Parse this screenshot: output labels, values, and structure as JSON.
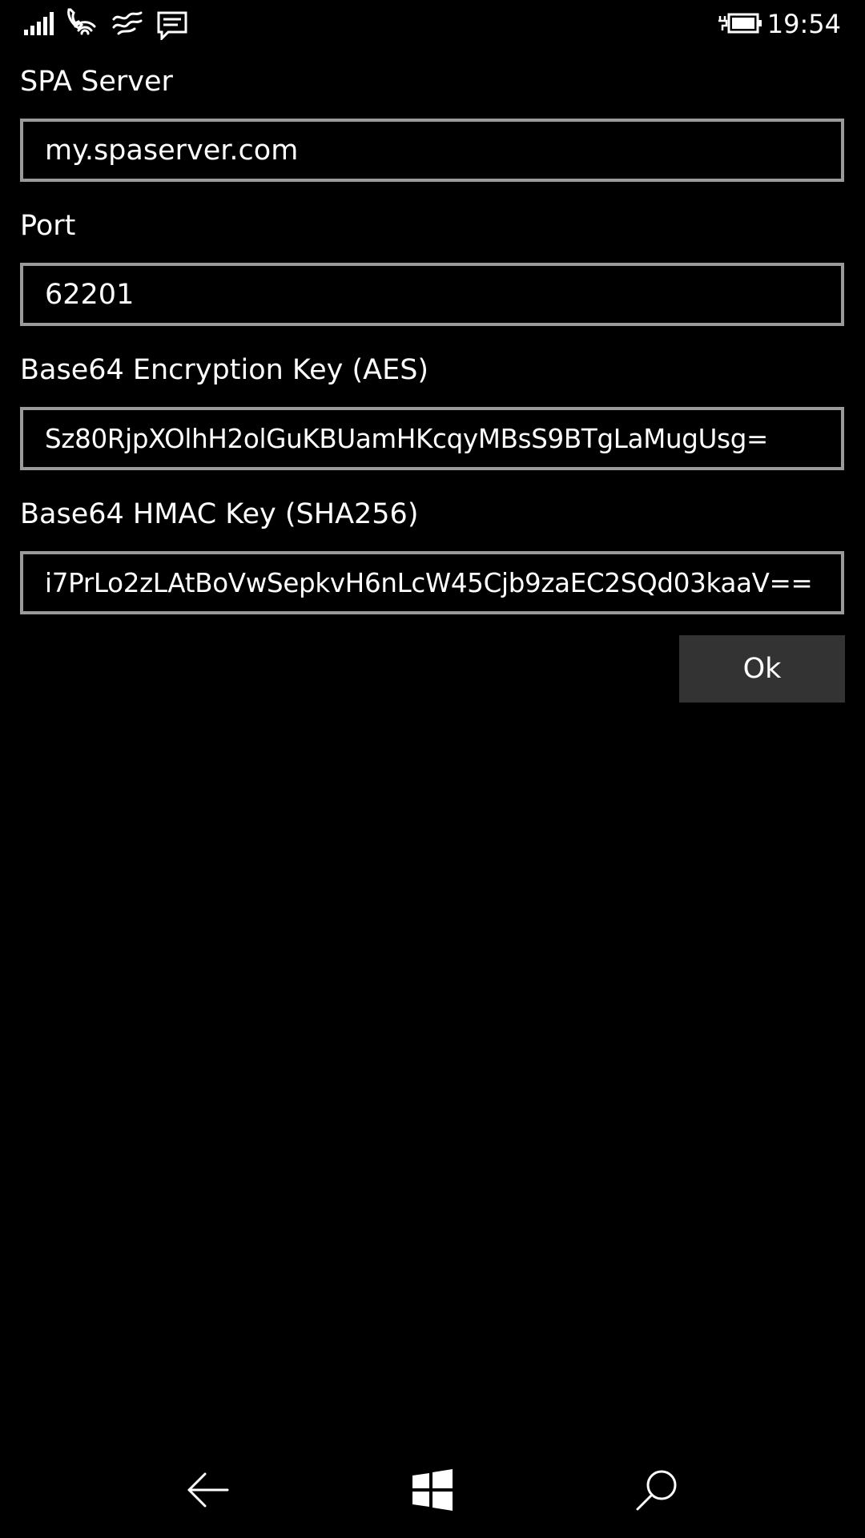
{
  "status_bar": {
    "time": "19:54",
    "icons": [
      "signal-strength-icon",
      "wifi-calling-icon",
      "data-connection-icon",
      "message-notification-icon",
      "battery-charging-icon"
    ]
  },
  "form": {
    "spa_server": {
      "label": "SPA Server",
      "value": "my.spaserver.com"
    },
    "port": {
      "label": "Port",
      "value": "62201"
    },
    "encryption_key": {
      "label": "Base64 Encryption Key (AES)",
      "value": "Sz80RjpXOlhH2olGuKBUamHKcqyMBsS9BTgLaMugUsg="
    },
    "hmac_key": {
      "label": "Base64 HMAC Key (SHA256)",
      "value": "i7PrLo2zLAtBoVwSepkvH6nLcW45Cjb9zaEC2SQd03kaaV=="
    },
    "ok_label": "Ok"
  },
  "nav_bar": {
    "buttons": [
      "back-arrow-icon",
      "windows-start-icon",
      "search-icon"
    ]
  },
  "colors": {
    "background": "#000000",
    "text": "#ffffff",
    "field_border": "#9a9a9a",
    "button_background": "#333333"
  }
}
